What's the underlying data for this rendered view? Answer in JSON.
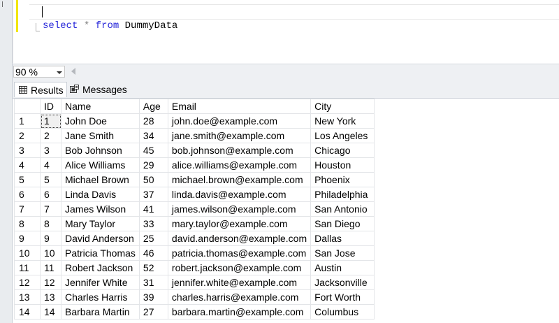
{
  "editor": {
    "kw_select": "select",
    "op_star": "*",
    "kw_from": "from",
    "table_name": "DummyData"
  },
  "zoom": {
    "level": "90 %"
  },
  "tabs": [
    {
      "label": "Results",
      "icon": "grid-icon"
    },
    {
      "label": "Messages",
      "icon": "messages-icon"
    }
  ],
  "results": {
    "columns": [
      "ID",
      "Name",
      "Age",
      "Email",
      "City"
    ],
    "rows": [
      [
        "1",
        "1",
        "John Doe",
        "28",
        "john.doe@example.com",
        "New York"
      ],
      [
        "2",
        "2",
        "Jane Smith",
        "34",
        "jane.smith@example.com",
        "Los Angeles"
      ],
      [
        "3",
        "3",
        "Bob Johnson",
        "45",
        "bob.johnson@example.com",
        "Chicago"
      ],
      [
        "4",
        "4",
        "Alice Williams",
        "29",
        "alice.williams@example.com",
        "Houston"
      ],
      [
        "5",
        "5",
        "Michael Brown",
        "50",
        "michael.brown@example.com",
        "Phoenix"
      ],
      [
        "6",
        "6",
        "Linda Davis",
        "37",
        "linda.davis@example.com",
        "Philadelphia"
      ],
      [
        "7",
        "7",
        "James Wilson",
        "41",
        "james.wilson@example.com",
        "San Antonio"
      ],
      [
        "8",
        "8",
        "Mary Taylor",
        "33",
        "mary.taylor@example.com",
        "San Diego"
      ],
      [
        "9",
        "9",
        "David Anderson",
        "25",
        "david.anderson@example.com",
        "Dallas"
      ],
      [
        "10",
        "10",
        "Patricia Thomas",
        "46",
        "patricia.thomas@example.com",
        "San Jose"
      ],
      [
        "11",
        "11",
        "Robert Jackson",
        "52",
        "robert.jackson@example.com",
        "Austin"
      ],
      [
        "12",
        "12",
        "Jennifer White",
        "31",
        "jennifer.white@example.com",
        "Jacksonville"
      ],
      [
        "13",
        "13",
        "Charles Harris",
        "39",
        "charles.harris@example.com",
        "Fort Worth"
      ],
      [
        "14",
        "14",
        "Barbara Martin",
        "27",
        "barbara.martin@example.com",
        "Columbus"
      ]
    ]
  }
}
